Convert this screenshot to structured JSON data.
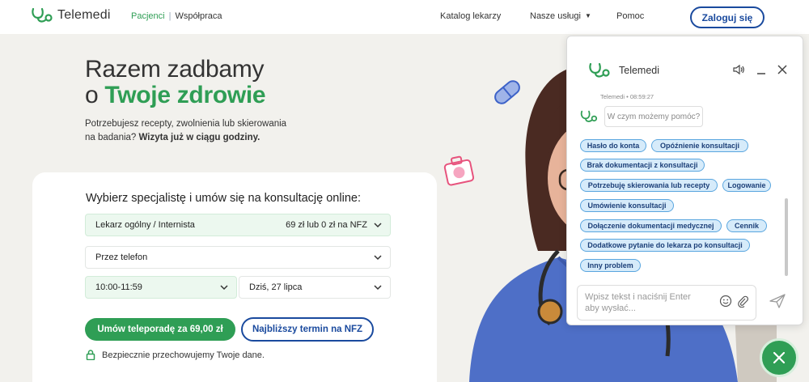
{
  "header": {
    "logo_text": "Telemedi",
    "nav_patients": "Pacjenci",
    "nav_separator": "|",
    "nav_cooperation": "Współpraca",
    "nav_catalog": "Katalog lekarzy",
    "nav_services": "Nasze usługi",
    "nav_help": "Pomoc",
    "login": "Zaloguj się"
  },
  "hero": {
    "title_line1": "Razem zadbamy",
    "title_o": "o ",
    "title_green": "Twoje zdrowie",
    "subtitle_text": "Potrzebujesz recepty, zwolnienia lub skierowania na badania? ",
    "subtitle_bold": "Wizyta już w ciągu godziny."
  },
  "booking": {
    "title": "Wybierz specjalistę i umów się na konsultację online:",
    "specialist": "Lekarz ogólny / Internista",
    "specialist_price": "69 zł lub 0 zł na NFZ",
    "contact_method": "Przez telefon",
    "time": "10:00-11:59",
    "date": "Dziś, 27 lipca",
    "primary_button": "Umów teleporadę za 69,00 zł",
    "secondary_button": "Najbliższy termin na NFZ",
    "secure_note": "Bezpiecznie przechowujemy Twoje dane."
  },
  "chat": {
    "title": "Telemedi",
    "sender": "Telemedi",
    "dot": "•",
    "time": "08:59:27",
    "bot_message": "W czym możemy pomóc?",
    "chips": [
      "Hasło do konta",
      "Opóźnienie konsultacji",
      "Brak dokumentacji z konsultacji",
      "Potrzebuję skierowania lub recepty",
      "Logowanie",
      "Umówienie konsultacji",
      "Dołączenie dokumentacji medycznej",
      "Cennik",
      "Dodatkowe pytanie do lekarza po konsultacji",
      "Inny problem"
    ],
    "input_placeholder": "Wpisz tekst i naciśnij Enter aby wysłać..."
  },
  "colors": {
    "brand_green": "#2f9e55",
    "brand_blue": "#1a4a9e",
    "chip_bg": "#d6ebfa",
    "chip_border": "#5aa6df"
  }
}
